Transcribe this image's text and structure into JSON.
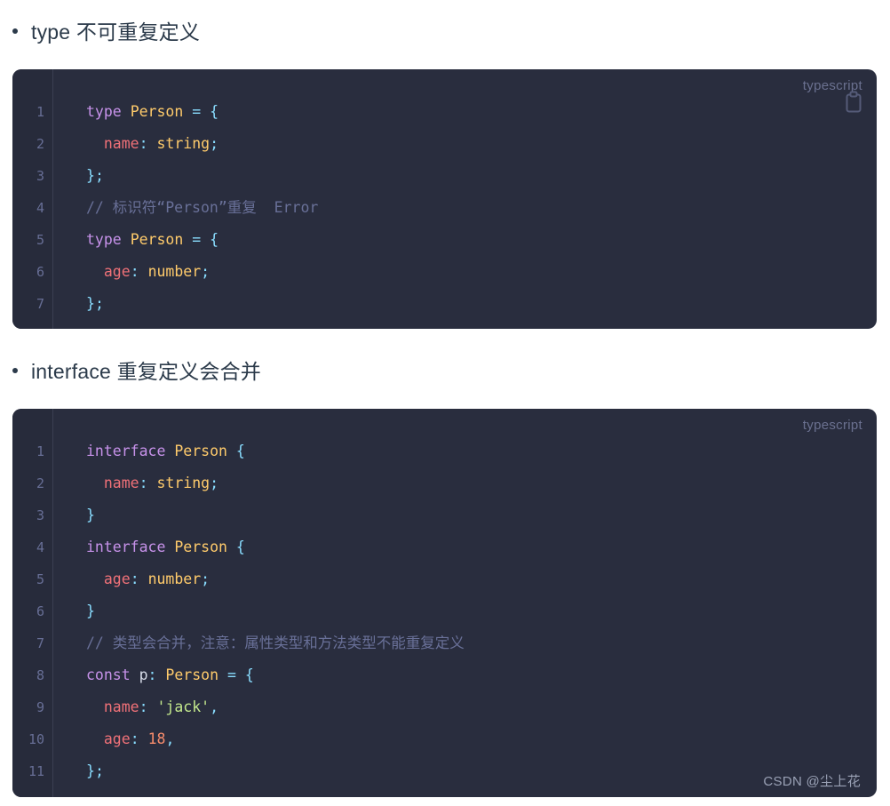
{
  "page": {
    "background": "#ffffff",
    "code_background": "#292d3e",
    "gutter_background": "#272b3b",
    "heading_color": "#2b3a4a"
  },
  "sections": [
    {
      "heading": "type 不可重复定义",
      "code": {
        "language_label": "typescript",
        "copy_icon": "clipboard-copy-icon",
        "line_numbers": [
          "1",
          "2",
          "3",
          "4",
          "5",
          "6",
          "7"
        ],
        "lines": [
          [
            {
              "t": "type",
              "c": "t-kw"
            },
            {
              "t": " ",
              "c": "t-plain"
            },
            {
              "t": "Person",
              "c": "t-type"
            },
            {
              "t": " ",
              "c": "t-plain"
            },
            {
              "t": "=",
              "c": "t-op"
            },
            {
              "t": " ",
              "c": "t-plain"
            },
            {
              "t": "{",
              "c": "t-punc"
            }
          ],
          [
            {
              "t": "  ",
              "c": "t-plain"
            },
            {
              "t": "name",
              "c": "t-prop"
            },
            {
              "t": ":",
              "c": "t-punc"
            },
            {
              "t": " ",
              "c": "t-plain"
            },
            {
              "t": "string",
              "c": "t-type"
            },
            {
              "t": ";",
              "c": "t-punc"
            }
          ],
          [
            {
              "t": "}",
              "c": "t-punc"
            },
            {
              "t": ";",
              "c": "t-punc"
            }
          ],
          [
            {
              "t": "// 标识符“Person”重复  Error",
              "c": "t-cmt"
            }
          ],
          [
            {
              "t": "type",
              "c": "t-kw"
            },
            {
              "t": " ",
              "c": "t-plain"
            },
            {
              "t": "Person",
              "c": "t-type"
            },
            {
              "t": " ",
              "c": "t-plain"
            },
            {
              "t": "=",
              "c": "t-op"
            },
            {
              "t": " ",
              "c": "t-plain"
            },
            {
              "t": "{",
              "c": "t-punc"
            }
          ],
          [
            {
              "t": "  ",
              "c": "t-plain"
            },
            {
              "t": "age",
              "c": "t-prop"
            },
            {
              "t": ":",
              "c": "t-punc"
            },
            {
              "t": " ",
              "c": "t-plain"
            },
            {
              "t": "number",
              "c": "t-type"
            },
            {
              "t": ";",
              "c": "t-punc"
            }
          ],
          [
            {
              "t": "}",
              "c": "t-punc"
            },
            {
              "t": ";",
              "c": "t-punc"
            }
          ]
        ],
        "plain_text": "type Person = {\n  name: string;\n};\n// 标识符“Person”重复  Error\ntype Person = {\n  age: number;\n};"
      }
    },
    {
      "heading": "interface 重复定义会合并",
      "code": {
        "language_label": "typescript",
        "copy_icon": null,
        "line_numbers": [
          "1",
          "2",
          "3",
          "4",
          "5",
          "6",
          "7",
          "8",
          "9",
          "10",
          "11"
        ],
        "lines": [
          [
            {
              "t": "interface",
              "c": "t-kw"
            },
            {
              "t": " ",
              "c": "t-plain"
            },
            {
              "t": "Person",
              "c": "t-type"
            },
            {
              "t": " ",
              "c": "t-plain"
            },
            {
              "t": "{",
              "c": "t-punc"
            }
          ],
          [
            {
              "t": "  ",
              "c": "t-plain"
            },
            {
              "t": "name",
              "c": "t-prop"
            },
            {
              "t": ":",
              "c": "t-punc"
            },
            {
              "t": " ",
              "c": "t-plain"
            },
            {
              "t": "string",
              "c": "t-type"
            },
            {
              "t": ";",
              "c": "t-punc"
            }
          ],
          [
            {
              "t": "}",
              "c": "t-punc"
            }
          ],
          [
            {
              "t": "interface",
              "c": "t-kw"
            },
            {
              "t": " ",
              "c": "t-plain"
            },
            {
              "t": "Person",
              "c": "t-type"
            },
            {
              "t": " ",
              "c": "t-plain"
            },
            {
              "t": "{",
              "c": "t-punc"
            }
          ],
          [
            {
              "t": "  ",
              "c": "t-plain"
            },
            {
              "t": "age",
              "c": "t-prop"
            },
            {
              "t": ":",
              "c": "t-punc"
            },
            {
              "t": " ",
              "c": "t-plain"
            },
            {
              "t": "number",
              "c": "t-type"
            },
            {
              "t": ";",
              "c": "t-punc"
            }
          ],
          [
            {
              "t": "}",
              "c": "t-punc"
            }
          ],
          [
            {
              "t": "// 类型会合并，注意：属性类型和方法类型不能重复定义",
              "c": "t-cmt"
            }
          ],
          [
            {
              "t": "const",
              "c": "t-kw"
            },
            {
              "t": " ",
              "c": "t-plain"
            },
            {
              "t": "p",
              "c": "t-var"
            },
            {
              "t": ":",
              "c": "t-punc"
            },
            {
              "t": " ",
              "c": "t-plain"
            },
            {
              "t": "Person",
              "c": "t-type"
            },
            {
              "t": " ",
              "c": "t-plain"
            },
            {
              "t": "=",
              "c": "t-op"
            },
            {
              "t": " ",
              "c": "t-plain"
            },
            {
              "t": "{",
              "c": "t-punc"
            }
          ],
          [
            {
              "t": "  ",
              "c": "t-plain"
            },
            {
              "t": "name",
              "c": "t-prop"
            },
            {
              "t": ":",
              "c": "t-punc"
            },
            {
              "t": " ",
              "c": "t-plain"
            },
            {
              "t": "'jack'",
              "c": "t-str"
            },
            {
              "t": ",",
              "c": "t-punc"
            }
          ],
          [
            {
              "t": "  ",
              "c": "t-plain"
            },
            {
              "t": "age",
              "c": "t-prop"
            },
            {
              "t": ":",
              "c": "t-punc"
            },
            {
              "t": " ",
              "c": "t-plain"
            },
            {
              "t": "18",
              "c": "t-num"
            },
            {
              "t": ",",
              "c": "t-punc"
            }
          ],
          [
            {
              "t": "}",
              "c": "t-punc"
            },
            {
              "t": ";",
              "c": "t-punc"
            }
          ]
        ],
        "plain_text": "interface Person {\n  name: string;\n}\ninterface Person {\n  age: number;\n}\n// 类型会合并，注意：属性类型和方法类型不能重复定义\nconst p: Person = {\n  name: 'jack',\n  age: 18,\n};"
      }
    }
  ],
  "watermark": "CSDN @尘上花"
}
